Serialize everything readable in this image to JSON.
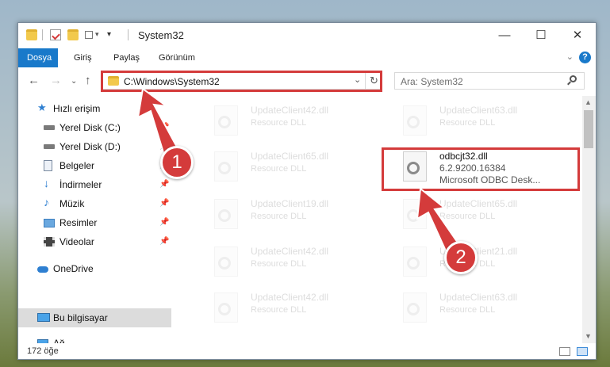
{
  "window": {
    "title": "System32"
  },
  "ribbon": {
    "tabs": [
      "Dosya",
      "Giriş",
      "Paylaş",
      "Görünüm"
    ],
    "help": "?"
  },
  "address": {
    "path": "C:\\Windows\\System32"
  },
  "search": {
    "placeholder": "Ara: System32"
  },
  "sidebar": {
    "items": [
      {
        "label": "Hızlı erişim",
        "icon": "star-icon"
      },
      {
        "label": "Yerel Disk (C:)",
        "icon": "drive-icon"
      },
      {
        "label": "Yerel Disk (D:)",
        "icon": "drive-icon"
      },
      {
        "label": "Belgeler",
        "icon": "documents-icon"
      },
      {
        "label": "İndirmeler",
        "icon": "download-icon"
      },
      {
        "label": "Müzik",
        "icon": "music-icon"
      },
      {
        "label": "Resimler",
        "icon": "pictures-icon"
      },
      {
        "label": "Videolar",
        "icon": "videos-icon"
      },
      {
        "label": "OneDrive",
        "icon": "cloud-icon"
      },
      {
        "label": "Bu bilgisayar",
        "icon": "computer-icon"
      },
      {
        "label": "Ağ",
        "icon": "network-icon"
      }
    ]
  },
  "files": [
    {
      "name": "UpdateClient42.dll",
      "desc": "Resource DLL"
    },
    {
      "name": "UpdateClient63.dll",
      "desc": "Resource DLL"
    },
    {
      "name": "UpdateClient65.dll",
      "desc": "Resource DLL"
    },
    {
      "name": "odbcjt32.dll",
      "version": "6.2.9200.16384",
      "desc": "Microsoft ODBC Desk..."
    },
    {
      "name": "UpdateClient19.dll",
      "desc": "Resource DLL"
    },
    {
      "name": "UpdateClient65.dll",
      "desc": "Resource DLL"
    },
    {
      "name": "UpdateClient42.dll",
      "desc": "Resource DLL"
    },
    {
      "name": "UpdateClient21.dll",
      "desc": "Resource DLL"
    },
    {
      "name": "UpdateClient42.dll",
      "desc": "Resource DLL"
    },
    {
      "name": "UpdateClient63.dll",
      "desc": "Resource DLL"
    }
  ],
  "status": {
    "count": "172 öğe"
  },
  "annotations": {
    "step1": "1",
    "step2": "2"
  },
  "colors": {
    "accent": "#1979ca",
    "highlight": "#d43b3b"
  }
}
